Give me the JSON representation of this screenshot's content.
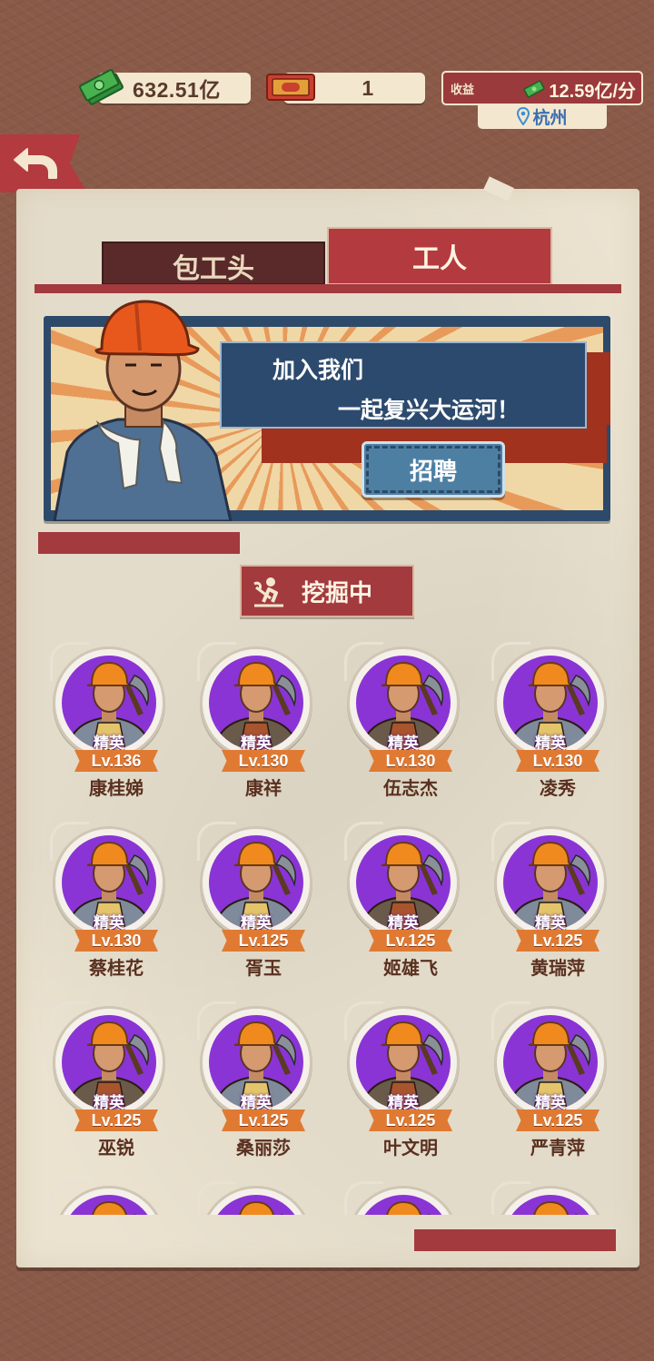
{
  "colors": {
    "brand_red": "#b33a3e",
    "dark_tab": "#5a2a2a",
    "panel_bg": "#ebe3d0",
    "elite_purple": "#8a34d6",
    "level_orange": "#e07a32",
    "city_blue": "#3b6fb0"
  },
  "top_bar": {
    "cash_value": "632.51亿",
    "cash_icon": "cash-stack-icon",
    "ticket_value": "1",
    "ticket_icon": "ticket-icon",
    "income_label": "收益",
    "income_value": "12.59亿/分",
    "income_icon": "cash-icon",
    "city": "杭州",
    "city_icon": "location-pin-icon"
  },
  "nav": {
    "back_icon": "back-arrow-icon"
  },
  "tabs": [
    {
      "label": "包工头",
      "active": false
    },
    {
      "label": "工人",
      "active": true
    }
  ],
  "banner": {
    "line1": "加入我们",
    "line2": "一起复兴大运河！",
    "button_label": "招聘"
  },
  "status": {
    "label": "挖掘中",
    "icon": "digging-worker-icon"
  },
  "workers": [
    {
      "rank": "精英",
      "level": "Lv.136",
      "name": "康桂娣",
      "gender": "f"
    },
    {
      "rank": "精英",
      "level": "Lv.130",
      "name": "康祥",
      "gender": "m"
    },
    {
      "rank": "精英",
      "level": "Lv.130",
      "name": "伍志杰",
      "gender": "m"
    },
    {
      "rank": "精英",
      "level": "Lv.130",
      "name": "凌秀",
      "gender": "f"
    },
    {
      "rank": "精英",
      "level": "Lv.130",
      "name": "蔡桂花",
      "gender": "f"
    },
    {
      "rank": "精英",
      "level": "Lv.125",
      "name": "胥玉",
      "gender": "f"
    },
    {
      "rank": "精英",
      "level": "Lv.125",
      "name": "姬雄飞",
      "gender": "m"
    },
    {
      "rank": "精英",
      "level": "Lv.125",
      "name": "黄瑞萍",
      "gender": "f"
    },
    {
      "rank": "精英",
      "level": "Lv.125",
      "name": "巫锐",
      "gender": "m"
    },
    {
      "rank": "精英",
      "level": "Lv.125",
      "name": "桑丽莎",
      "gender": "f"
    },
    {
      "rank": "精英",
      "level": "Lv.125",
      "name": "叶文明",
      "gender": "m"
    },
    {
      "rank": "精英",
      "level": "Lv.125",
      "name": "严青萍",
      "gender": "f"
    },
    {
      "rank": "",
      "level": "",
      "name": "",
      "gender": "f"
    },
    {
      "rank": "",
      "level": "",
      "name": "",
      "gender": "m"
    },
    {
      "rank": "",
      "level": "",
      "name": "",
      "gender": "m"
    },
    {
      "rank": "",
      "level": "",
      "name": "",
      "gender": "f"
    }
  ]
}
